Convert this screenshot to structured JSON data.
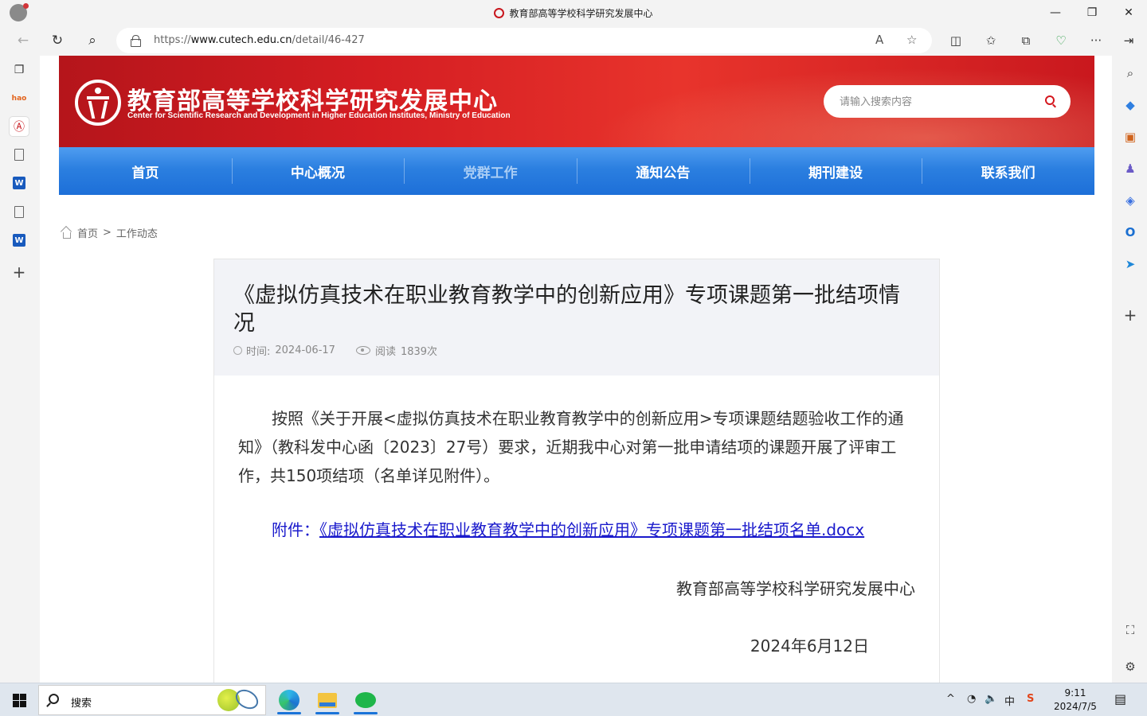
{
  "window": {
    "title": "教育部高等学校科学研究发展中心",
    "minimize": "—",
    "restore": "❐",
    "close": "✕"
  },
  "browser": {
    "url_prefix": "https://",
    "url_host": "www.cutech.edu.cn",
    "url_path": "/detail/46-427",
    "back": "←",
    "reload": "↻",
    "search": "⌕",
    "read_aloud": "A",
    "favorite": "☆",
    "split": "◫",
    "favorites": "✩",
    "collections": "⧉",
    "performance": "♡",
    "more": "···",
    "sidebar_toggle": "⇥"
  },
  "left_sidebar": {
    "tabs": "❐",
    "hao": "hao",
    "cutech": "Ⓐ",
    "add": "+",
    "word": "W"
  },
  "right_sidebar": {
    "search": "⌕",
    "tag": "◆",
    "tools": "▣",
    "games": "♟",
    "copilot": "◈",
    "outlook": "O",
    "send": "➤",
    "add": "+",
    "screenshot": "⛶",
    "settings": "⚙"
  },
  "site": {
    "name_cn": "教育部高等学校科学研究发展中心",
    "name_en": "Center for Scientific Research and Development in Higher Education Institutes, Ministry of Education",
    "search_placeholder": "请输入搜索内容"
  },
  "nav": [
    {
      "label": "首页"
    },
    {
      "label": "中心概况"
    },
    {
      "label": "党群工作"
    },
    {
      "label": "通知公告"
    },
    {
      "label": "期刊建设"
    },
    {
      "label": "联系我们"
    }
  ],
  "breadcrumb": {
    "home": "首页",
    "sep": ">",
    "current": "工作动态"
  },
  "article": {
    "title": "《虚拟仿真技术在职业教育教学中的创新应用》专项课题第一批结项情况",
    "time_label": "时间:",
    "time_value": "2024-06-17",
    "read_label": "阅读",
    "read_value": "1839次",
    "body": "按照《关于开展<虚拟仿真技术在职业教育教学中的创新应用>专项课题结题验收工作的通知》（教科发中心函〔2023〕27号）要求，近期我中心对第一批申请结项的课题开展了评审工作，共150项结项（名单详见附件）。",
    "attachment_label": "附件：",
    "attachment_link": "《虚拟仿真技术在职业教育教学中的创新应用》专项课题第一批结项名单.docx",
    "signature": "教育部高等学校科学研究发展中心",
    "date": "2024年6月12日"
  },
  "taskbar": {
    "search_label": "搜索",
    "tray_up": "^",
    "wifi": "◔",
    "volume": "🔈",
    "ime": "中",
    "sogou": "S",
    "time": "9:11",
    "date": "2024/7/5",
    "notification": "▤"
  }
}
